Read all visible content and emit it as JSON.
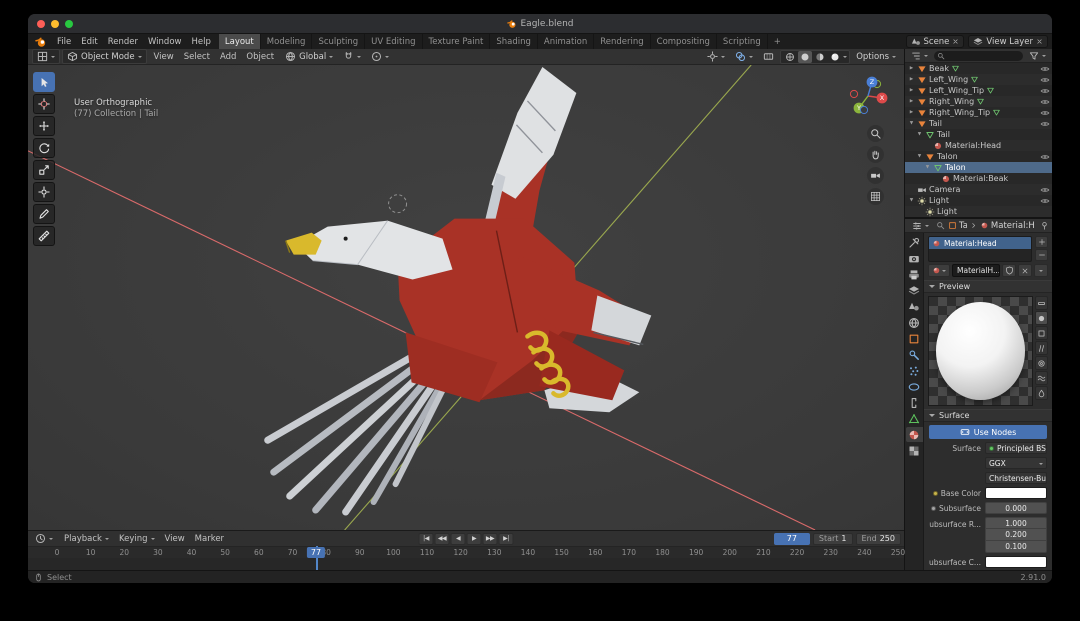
{
  "window": {
    "title": "Eagle.blend"
  },
  "topbar": {
    "menus": [
      "File",
      "Edit",
      "Render",
      "Window",
      "Help"
    ],
    "workspaces": [
      "Layout",
      "Modeling",
      "Sculpting",
      "UV Editing",
      "Texture Paint",
      "Shading",
      "Animation",
      "Rendering",
      "Compositing",
      "Scripting"
    ],
    "active_workspace": "Layout",
    "add_workspace_label": "+",
    "scene_label": "Scene",
    "view_layer_label": "View Layer"
  },
  "viewport": {
    "mode": "Object Mode",
    "menus": [
      "View",
      "Select",
      "Add",
      "Object"
    ],
    "orientation": "Global",
    "options_label": "Options",
    "overlay_line1": "User Orthographic",
    "overlay_line2": "(77) Collection | Tail",
    "axis_gizmo": [
      {
        "axis": "X",
        "color": "#dd4a4a"
      },
      {
        "axis": "Y",
        "color": "#8bb43c"
      },
      {
        "axis": "Z",
        "color": "#4a7fd6"
      }
    ],
    "tools": [
      {
        "name": "select-box",
        "active": true
      },
      {
        "name": "cursor"
      },
      {
        "name": "move"
      },
      {
        "name": "rotate"
      },
      {
        "name": "scale"
      },
      {
        "name": "transform"
      },
      {
        "name": "annotate"
      },
      {
        "name": "measure"
      }
    ],
    "shading_modes": [
      {
        "name": "wireframe"
      },
      {
        "name": "solid",
        "active": true
      },
      {
        "name": "material-preview"
      },
      {
        "name": "rendered"
      }
    ],
    "nav_buttons": [
      "zoom",
      "pan",
      "camera-view",
      "toggle-grid"
    ]
  },
  "outliner": {
    "rows": [
      {
        "arrow": "collapsed",
        "icon": "object",
        "label": "Beak",
        "child_icons": [
          "mesh"
        ],
        "eye": true,
        "depth": 0
      },
      {
        "arrow": "collapsed",
        "icon": "object",
        "label": "Left_Wing",
        "child_icons": [
          "mesh"
        ],
        "eye": true,
        "depth": 0
      },
      {
        "arrow": "collapsed",
        "icon": "object",
        "label": "Left_Wing_Tip",
        "child_icons": [
          "mesh"
        ],
        "eye": true,
        "depth": 0
      },
      {
        "arrow": "collapsed",
        "icon": "object",
        "label": "Right_Wing",
        "child_icons": [
          "mesh"
        ],
        "eye": true,
        "depth": 0
      },
      {
        "arrow": "collapsed",
        "icon": "object",
        "label": "Right_Wing_Tip",
        "child_icons": [
          "mesh"
        ],
        "eye": true,
        "depth": 0
      },
      {
        "arrow": "expanded",
        "icon": "object",
        "label": "Tail",
        "eye": true,
        "depth": 0
      },
      {
        "arrow": "expanded",
        "icon": "mesh",
        "label": "Tail",
        "depth": 1
      },
      {
        "icon": "material",
        "label": "Material:Head",
        "depth": 2
      },
      {
        "arrow": "expanded",
        "icon": "object",
        "label": "Talon",
        "eye": true,
        "depth": 1
      },
      {
        "arrow": "expanded",
        "icon": "mesh",
        "label": "Talon",
        "selected": true,
        "depth": 2
      },
      {
        "icon": "material",
        "label": "Material:Beak",
        "depth": 3
      },
      {
        "icon": "camera",
        "label": "Camera",
        "eye": true,
        "depth": 0
      },
      {
        "arrow": "expanded",
        "icon": "light",
        "label": "Light",
        "eye": true,
        "depth": 0
      },
      {
        "icon": "light-data",
        "label": "Light",
        "depth": 1
      }
    ]
  },
  "properties": {
    "tabs": [
      {
        "name": "tool"
      },
      {
        "name": "render"
      },
      {
        "name": "output"
      },
      {
        "name": "view-layer"
      },
      {
        "name": "scene"
      },
      {
        "name": "world"
      },
      {
        "name": "object"
      },
      {
        "name": "modifiers"
      },
      {
        "name": "particles"
      },
      {
        "name": "physics"
      },
      {
        "name": "constraints"
      },
      {
        "name": "object-data"
      },
      {
        "name": "material",
        "active": true
      },
      {
        "name": "texture"
      }
    ],
    "breadcrumb": {
      "object": "Tail",
      "material": "Material:Head"
    },
    "slot": {
      "name": "Material:Head"
    },
    "datablock": {
      "name": "MaterialH..."
    },
    "preview": {
      "title": "Preview",
      "modes": [
        "flat",
        "sphere",
        "cube",
        "hair",
        "shaderball",
        "cloth",
        "fluid"
      ],
      "active_mode": "sphere"
    },
    "surface": {
      "title": "Surface",
      "use_nodes_label": "Use Nodes",
      "surface_label": "Surface",
      "shader": "Principled BSDF",
      "shader_socket_color": "#63c763",
      "distribution": "GGX",
      "subsurface_method": "Christensen-Burley",
      "rows": {
        "base_color": {
          "label": "Base Color",
          "socket": "#c8b54c",
          "value_color": "#ffffff"
        },
        "subsurface": {
          "label": "Subsurface",
          "socket": "#a5a5a5",
          "value": "0.000"
        },
        "subsurface_radius": {
          "label": "Subsurface R...",
          "socket": "#6b6bc8",
          "values": [
            "1.000",
            "0.200",
            "0.100"
          ]
        },
        "subsurface_color": {
          "label": "Subsurface C...",
          "socket": "#c8b54c",
          "value_color": "#ffffff"
        }
      }
    }
  },
  "timeline": {
    "menus": [
      {
        "label": "Playback",
        "caret": true
      },
      {
        "label": "Keying",
        "caret": true
      },
      {
        "label": "View",
        "caret": false
      },
      {
        "label": "Marker",
        "caret": false
      }
    ],
    "transport": [
      {
        "name": "jump-to-start",
        "glyph": "|◀"
      },
      {
        "name": "jump-to-prev-keyframe",
        "glyph": "◀◀"
      },
      {
        "name": "play-reverse",
        "glyph": "◀"
      },
      {
        "name": "play",
        "glyph": "▶"
      },
      {
        "name": "jump-to-next-keyframe",
        "glyph": "▶▶"
      },
      {
        "name": "jump-to-end",
        "glyph": "▶|"
      }
    ],
    "ticks": [
      0,
      10,
      20,
      30,
      40,
      50,
      60,
      70,
      80,
      90,
      100,
      110,
      120,
      130,
      140,
      150,
      160,
      170,
      180,
      190,
      200,
      210,
      220,
      230,
      240,
      250
    ],
    "frame_end_tick": 250,
    "current_frame": "77",
    "start_label": "Start",
    "start_value": "1",
    "end_label": "End",
    "end_value": "250"
  },
  "statusbar": {
    "left_hint": "Select",
    "version": "2.91.0"
  },
  "accent_color": "#4772b3"
}
